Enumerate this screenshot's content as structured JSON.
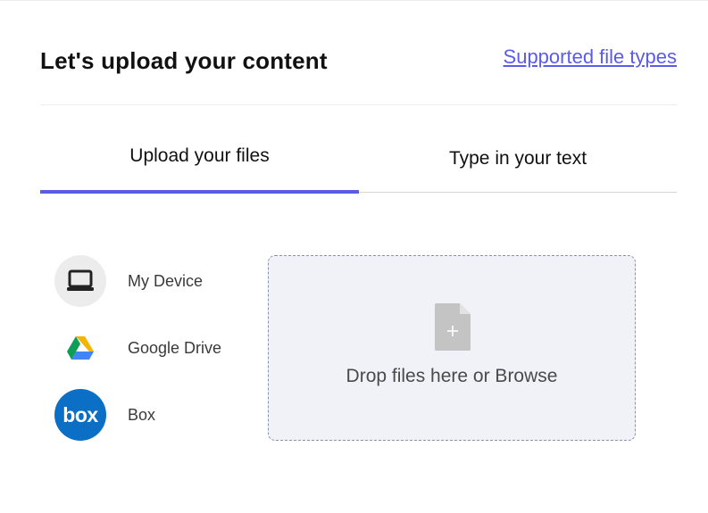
{
  "header": {
    "title": "Let's upload your content",
    "supported_link": "Supported file types"
  },
  "tabs": [
    {
      "label": "Upload your files",
      "active": true
    },
    {
      "label": "Type in your text",
      "active": false
    }
  ],
  "sources": [
    {
      "label": "My Device",
      "icon": "laptop-icon"
    },
    {
      "label": "Google Drive",
      "icon": "google-drive-icon"
    },
    {
      "label": "Box",
      "icon": "box-logo-icon",
      "icon_text": "box"
    }
  ],
  "drop_zone": {
    "text": "Drop files here or Browse",
    "icon": "file-add-icon"
  },
  "colors": {
    "accent": "#5b5bea",
    "box_brand": "#0b6fc5",
    "drop_zone_bg": "#f0f2f7"
  }
}
